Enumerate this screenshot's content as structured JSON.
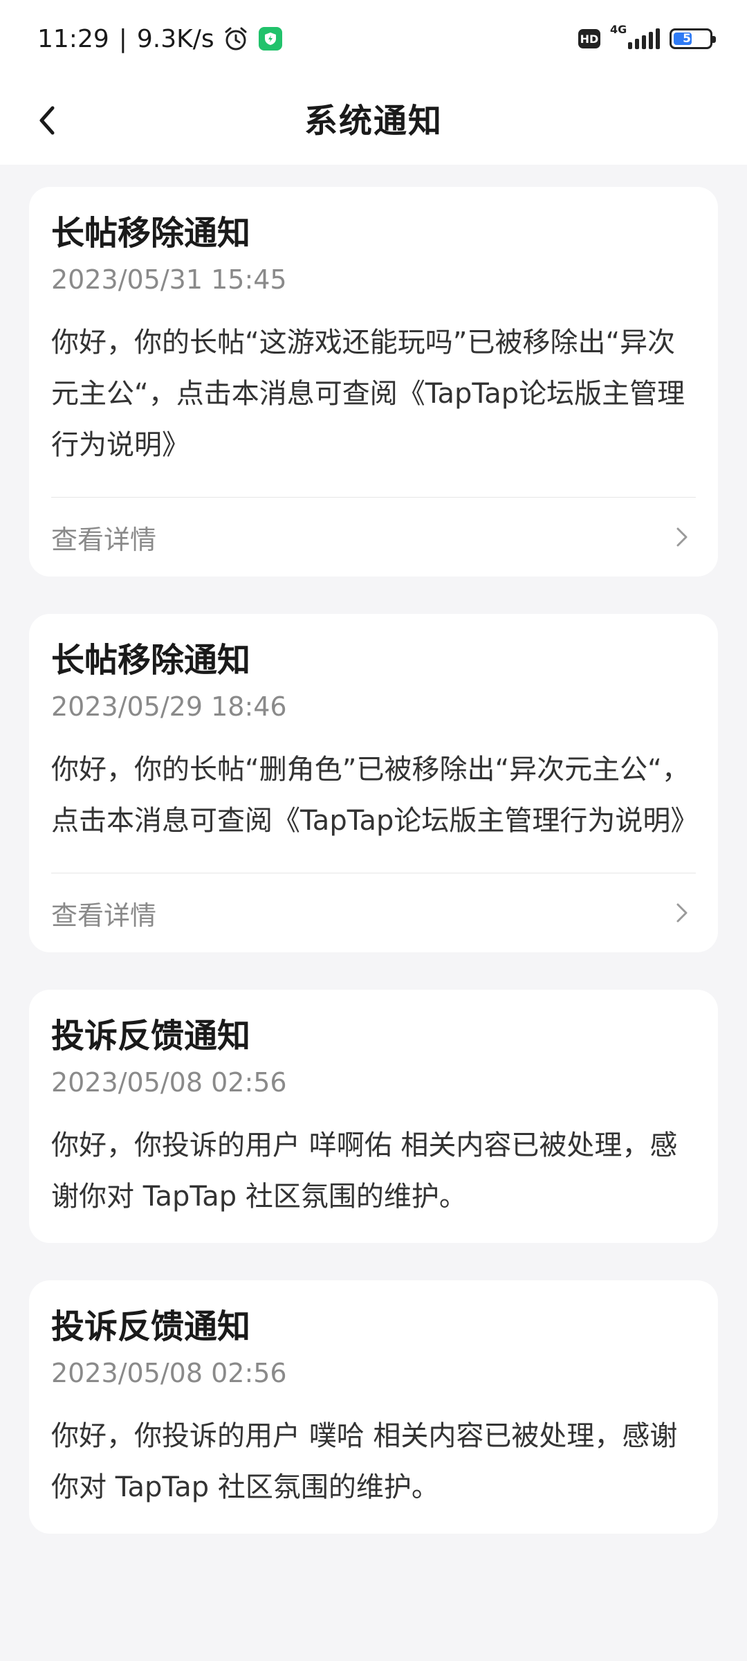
{
  "status_bar": {
    "time": "11:29",
    "separator": "|",
    "net_speed": "9.3K/s",
    "hd_badge": "HD",
    "network_type": "4G",
    "battery_level": "51",
    "battery_fraction": 0.51,
    "icons": [
      "alarm-icon",
      "shield-app-icon",
      "signal-icon",
      "battery-icon"
    ]
  },
  "header": {
    "title": "系统通知",
    "back_icon": "chevron-left-icon"
  },
  "notifications": [
    {
      "title": "长帖移除通知",
      "time": "2023/05/31 15:45",
      "body": "你好，你的长帖“这游戏还能玩吗”已被移除出“异次元主公“，点击本消息可查阅《TapTap论坛版主管理行为说明》",
      "detail_label": "查看详情"
    },
    {
      "title": "长帖移除通知",
      "time": "2023/05/29 18:46",
      "body": "你好，你的长帖“删角色”已被移除出“异次元主公“，点击本消息可查阅《TapTap论坛版主管理行为说明》",
      "detail_label": "查看详情"
    },
    {
      "title": "投诉反馈通知",
      "time": "2023/05/08 02:56",
      "body": "你好，你投诉的用户 咩啊佑 相关内容已被处理，感谢你对 TapTap 社区氛围的维护。"
    },
    {
      "title": "投诉反馈通知",
      "time": "2023/05/08 02:56",
      "body": "你好，你投诉的用户 噗哈 相关内容已被处理，感谢你对 TapTap 社区氛围的维护。"
    }
  ],
  "colors": {
    "background": "#f5f5f7",
    "card": "#ffffff",
    "secondary_text": "#8a8a8a",
    "battery_fill": "#2f7bf5",
    "app_icon": "#21c26b"
  }
}
